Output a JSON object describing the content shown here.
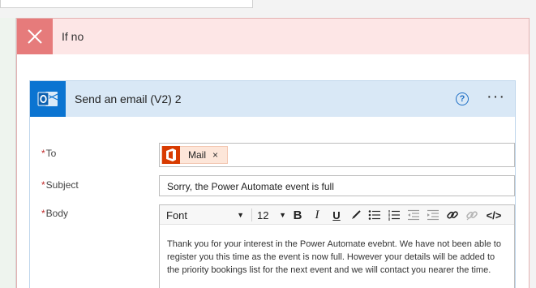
{
  "condition_block": {
    "title": "If no",
    "icon": "close-icon",
    "accent_color": "#e67b7b",
    "header_bg": "#fde6e6"
  },
  "action_card": {
    "title": "Send an email (V2) 2",
    "icon": "outlook-icon",
    "accent_color": "#0b74d1",
    "header_bg": "#d9e8f6",
    "help_glyph": "?",
    "more_glyph": "···"
  },
  "fields": {
    "to": {
      "label": "To",
      "required_mark": "*",
      "token": {
        "label": "Mail",
        "icon": "office-icon",
        "remove_glyph": "×"
      }
    },
    "subject": {
      "label": "Subject",
      "required_mark": "*",
      "value": "Sorry, the Power Automate event is full"
    },
    "body": {
      "label": "Body",
      "required_mark": "*",
      "font": "Font",
      "font_size": "12",
      "toolbar": {
        "bold": "B",
        "italic": "I",
        "underline": "U",
        "code": "</>"
      },
      "value": "Thank you for your interest in the Power Automate evebnt. We have not been able to register you this time as the event is now full. However your details will be added to the priority bookings list for the next event and we will contact you nearer the time."
    }
  }
}
